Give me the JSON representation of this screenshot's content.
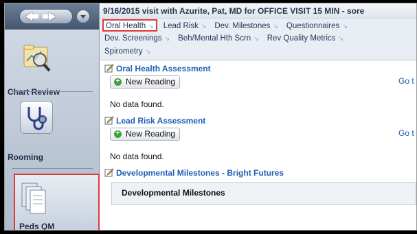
{
  "header": {
    "title": "9/16/2015 visit with Azurite, Pat, MD for OFFICE VISIT 15 MIN - sore"
  },
  "tabs": [
    {
      "label": "Oral Health",
      "active": true
    },
    {
      "label": "Lead Risk"
    },
    {
      "label": "Dev. Milestones"
    },
    {
      "label": "Questionnaires"
    },
    {
      "label": "Dev. Screenings"
    },
    {
      "label": "Beh/Mental Hth Scrn"
    },
    {
      "label": "Rev Quality Metrics"
    },
    {
      "label": "Spirometry"
    }
  ],
  "sidebar": {
    "activities": [
      {
        "label": "Chart Review",
        "icon": "chart-review-icon"
      },
      {
        "label": "Rooming",
        "icon": "stethoscope-icon"
      },
      {
        "label": "Peds QM",
        "icon": "documents-icon",
        "highlighted": true
      }
    ]
  },
  "sections": [
    {
      "title": "Oral Health Assessment",
      "button": "New Reading",
      "goto": "Go t",
      "empty": "No data found."
    },
    {
      "title": "Lead Risk Assessment",
      "button": "New Reading",
      "goto": "Go t",
      "empty": "No data found."
    },
    {
      "title": "Developmental Milestones - Bright Futures",
      "subheader": "Developmental Milestones"
    }
  ],
  "colors": {
    "highlight": "#e2393a",
    "link": "#1e5fb4"
  }
}
